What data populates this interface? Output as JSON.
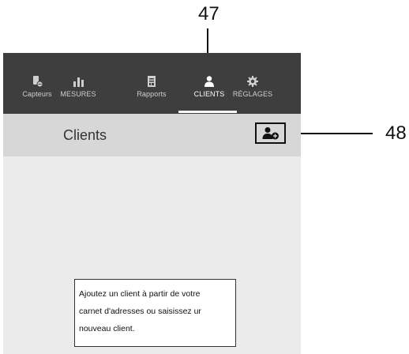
{
  "annotations": {
    "label_47": "47",
    "label_48": "48"
  },
  "tabs": [
    {
      "label": "Capteurs",
      "icon": "sensor-icon"
    },
    {
      "label": "MESURES",
      "icon": "bar-chart-icon"
    },
    {
      "label": "Rapports",
      "icon": "report-icon"
    },
    {
      "label": "CLIENTS",
      "icon": "person-icon",
      "active": true
    },
    {
      "label": "RÉGLAGES",
      "icon": "gear-icon"
    }
  ],
  "header": {
    "title": "Clients",
    "add_button_icon": "add-client-icon"
  },
  "hint": {
    "line1": "Ajoutez un client à partir de votre",
    "line2": "carnet d'adresses ou saisissez ur",
    "line3": "nouveau client."
  },
  "colors": {
    "topbar": "#3e3e3e",
    "header": "#d7d7d7",
    "content": "#ebebeb"
  }
}
